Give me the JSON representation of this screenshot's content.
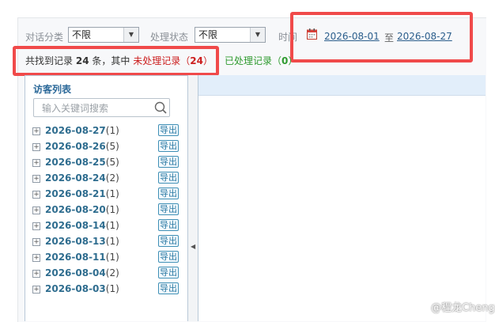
{
  "filters": {
    "dialog_type_label": "对话分类",
    "dialog_type_value": "不限",
    "status_label": "处理状态",
    "status_value": "不限",
    "time_label": "时间",
    "date_from": "2026-08-01",
    "date_sep": "至",
    "date_to": "2026-08-27"
  },
  "stats": {
    "prefix": "共找到记录",
    "total": "24",
    "unit": "条，其中",
    "unprocessed_label": "未处理记录（",
    "unprocessed_count": "24",
    "unprocessed_close": "）",
    "processed_label": "已处理记录（",
    "processed_count": "0",
    "processed_close": "）"
  },
  "visitor_list": {
    "title": "访客列表",
    "search_placeholder": "输入关键词搜索",
    "export_label": "导出",
    "items": [
      {
        "date": "2026-08-27",
        "count": "(1)"
      },
      {
        "date": "2026-08-26",
        "count": "(5)"
      },
      {
        "date": "2026-08-25",
        "count": "(5)"
      },
      {
        "date": "2026-08-24",
        "count": "(2)"
      },
      {
        "date": "2026-08-21",
        "count": "(1)"
      },
      {
        "date": "2026-08-20",
        "count": "(1)"
      },
      {
        "date": "2026-08-14",
        "count": "(1)"
      },
      {
        "date": "2026-08-13",
        "count": "(1)"
      },
      {
        "date": "2026-08-11",
        "count": "(1)"
      },
      {
        "date": "2026-08-04",
        "count": "(2)"
      },
      {
        "date": "2026-08-03",
        "count": "(1)"
      }
    ]
  },
  "watermark": "@程龙Cheng",
  "colors": {
    "highlight_red": "#f04a4a",
    "unprocessed": "#cc1f1f",
    "processed": "#2e9a2e",
    "link_blue": "#2b5e8c"
  }
}
